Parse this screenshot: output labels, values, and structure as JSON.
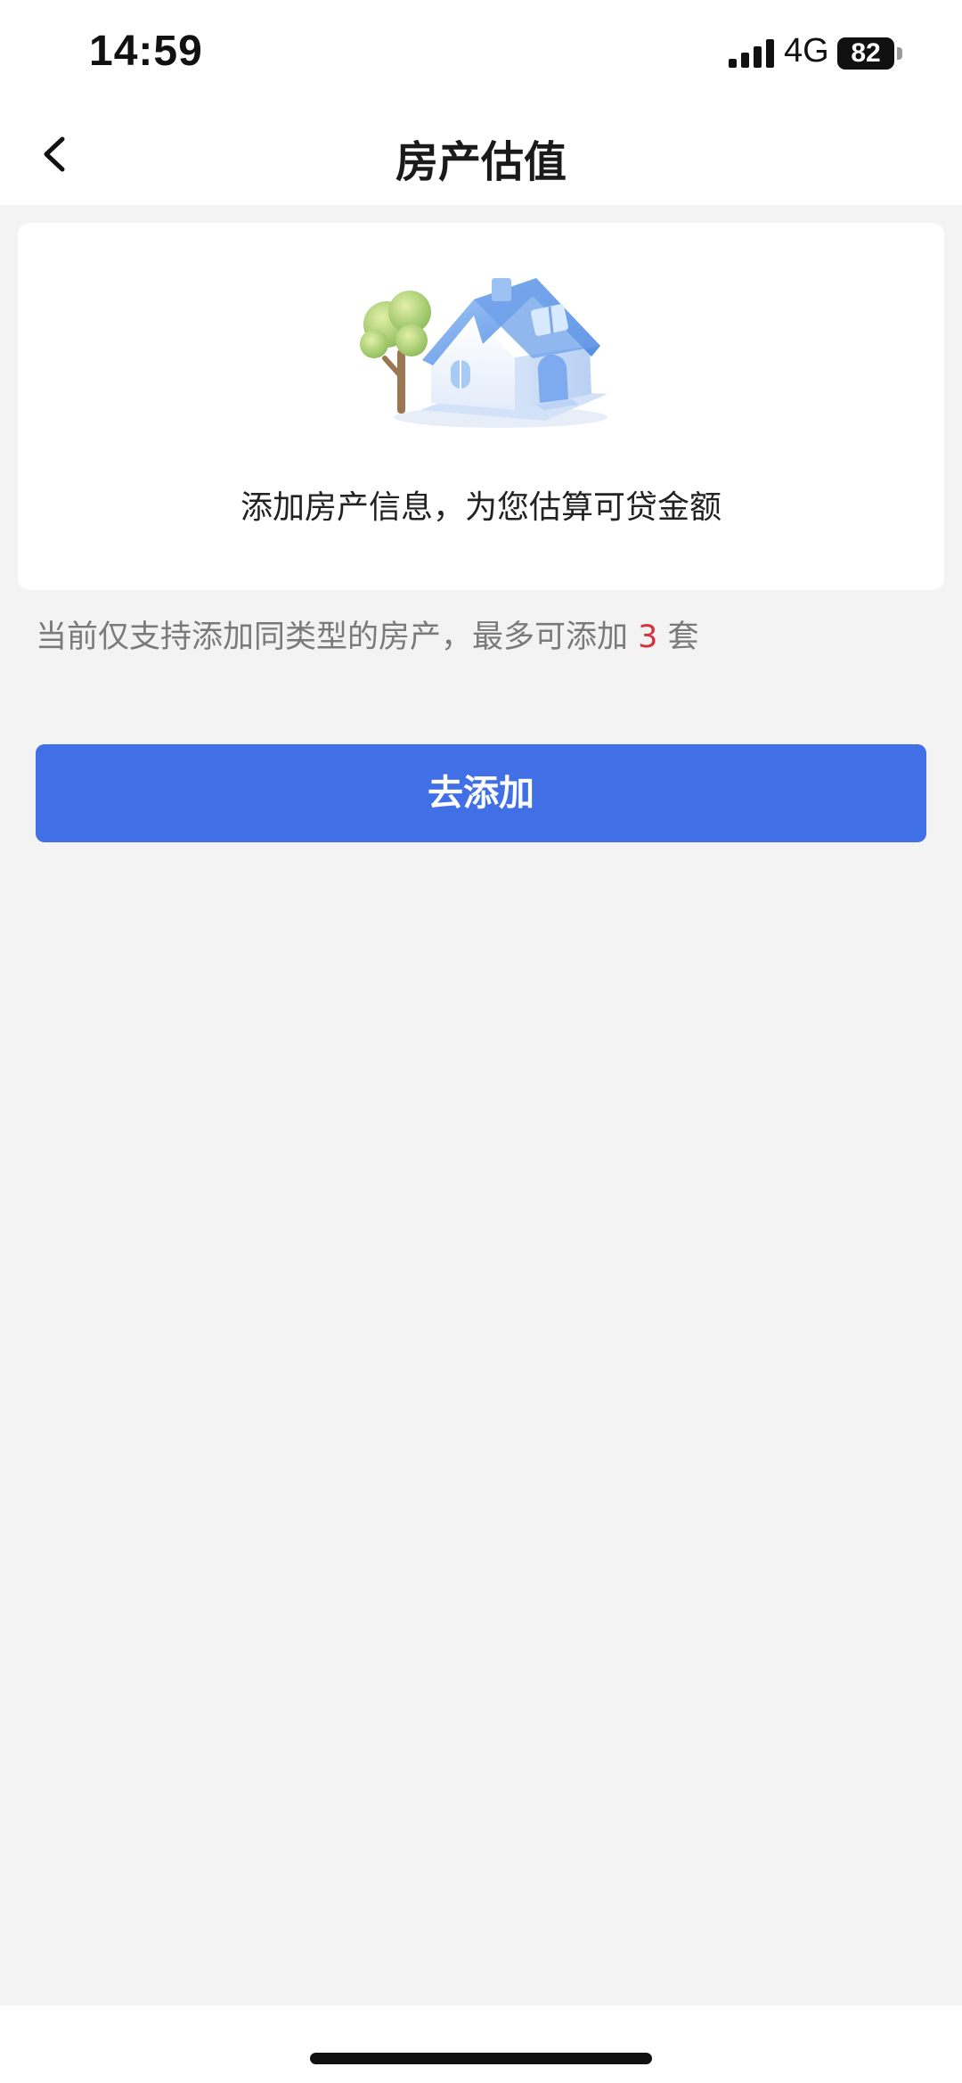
{
  "status_bar": {
    "time": "14:59",
    "network": "4G",
    "battery": "82",
    "icons": [
      "signal-icon",
      "battery-icon"
    ]
  },
  "nav": {
    "title": "房产估值",
    "back_icon": "chevron-left-icon"
  },
  "card": {
    "illustration": "house-illustration",
    "text": "添加房产信息，为您估算可贷金额"
  },
  "hint": {
    "prefix": "当前仅支持添加同类型的房产，最多可添加 ",
    "count": "3",
    "suffix": " 套"
  },
  "actions": {
    "add_label": "去添加"
  },
  "colors": {
    "primary": "#4170e6",
    "highlight": "#d6303a",
    "background": "#f3f3f4"
  }
}
